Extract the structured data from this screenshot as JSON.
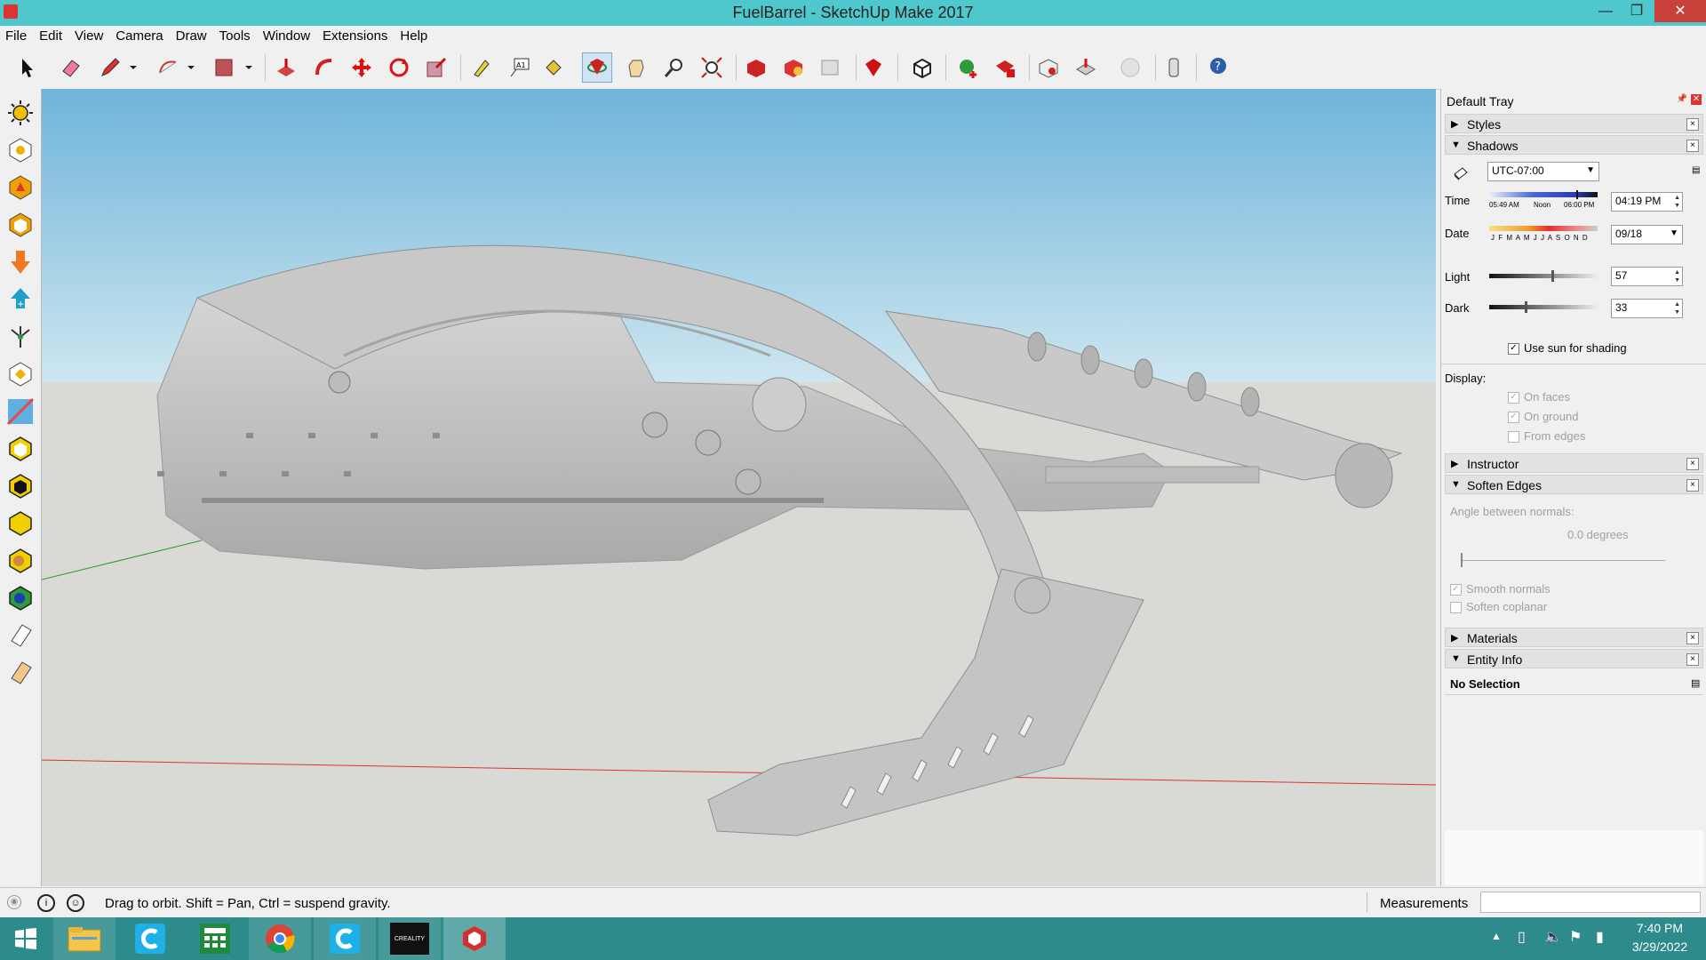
{
  "window": {
    "title": "FuelBarrel - SketchUp Make 2017",
    "minimize": "—",
    "maximize": "❐",
    "close": "✕"
  },
  "menu": [
    "File",
    "Edit",
    "View",
    "Camera",
    "Draw",
    "Tools",
    "Window",
    "Extensions",
    "Help"
  ],
  "toolbar_icons": [
    "select-icon",
    "eraser-icon",
    "pencil-icon",
    "dropdown-icon",
    "arc-icon",
    "dropdown-icon",
    "rectangle-icon",
    "dropdown-icon",
    "push-pull-icon",
    "follow-me-icon",
    "move-icon",
    "rotate-icon",
    "scale-icon",
    "tape-measure-icon",
    "text-icon",
    "paint-bucket-icon",
    "orbit-icon",
    "pan-icon",
    "zoom-icon",
    "zoom-extents-icon",
    "3d-warehouse-icon",
    "extension-warehouse-icon",
    "layout-icon",
    "extension-manager-icon",
    "component-icon",
    "add-location-icon",
    "toggle-terrain-icon",
    "photo-textures-icon",
    "share-model-icon",
    "preview-icon",
    "model-info-icon",
    "help-icon"
  ],
  "left_toolbar_icons": [
    "sun-icon",
    "sandbox-from-contours-icon",
    "sandbox-from-scratch-icon",
    "smoove-icon",
    "stamp-icon",
    "drape-icon",
    "add-detail-icon",
    "flip-edge-icon",
    "section-plane-icon",
    "solid-outer-shell-icon",
    "solid-intersect-icon",
    "solid-union-icon",
    "solid-subtract-icon",
    "solid-trim-icon",
    "solid-split-icon",
    "eraser-tool-icon",
    "paint-tool-icon"
  ],
  "tray": {
    "title": "Default Tray",
    "panels": {
      "styles": "Styles",
      "shadows": "Shadows",
      "instructor": "Instructor",
      "soften_edges": "Soften Edges",
      "materials": "Materials",
      "entity_info": "Entity Info"
    },
    "shadows": {
      "timezone": "UTC-07:00",
      "time_label": "Time",
      "time_ticks": [
        "05:49 AM",
        "Noon",
        "06:00 PM"
      ],
      "time_value": "04:19 PM",
      "date_label": "Date",
      "months": "J F M A M J J A S O N D",
      "date_value": "09/18",
      "light_label": "Light",
      "light_value": "57",
      "light_level": 0.57,
      "dark_label": "Dark",
      "dark_value": "33",
      "dark_level": 0.33,
      "use_sun": "Use sun for shading",
      "display_label": "Display:",
      "on_faces": "On faces",
      "on_ground": "On ground",
      "from_edges": "From edges"
    },
    "soften": {
      "angle_label": "Angle between normals:",
      "angle_value": "0.0  degrees",
      "smooth_normals": "Smooth normals",
      "soften_coplanar": "Soften coplanar"
    },
    "entity_info": {
      "selection": "No Selection"
    }
  },
  "status": {
    "hint": "Drag to orbit. Shift = Pan, Ctrl = suspend gravity.",
    "measurements_label": "Measurements",
    "measurements_value": ""
  },
  "taskbar": {
    "apps": [
      "start-button",
      "file-explorer-icon",
      "ccleaner-icon",
      "calculator-icon",
      "chrome-icon",
      "ccleaner-icon",
      "creality-icon",
      "sketchup-icon"
    ],
    "creality_label": "CREALITY",
    "time": "7:40 PM",
    "date": "3/29/2022"
  },
  "colors": {
    "titlebar": "#4fc8cd",
    "taskbar": "#2e8b8c",
    "sky_top": "#6fb4da",
    "sky_bottom": "#c9e3ee",
    "ground": "#d9d9d6",
    "model": "#c4c4c4"
  }
}
